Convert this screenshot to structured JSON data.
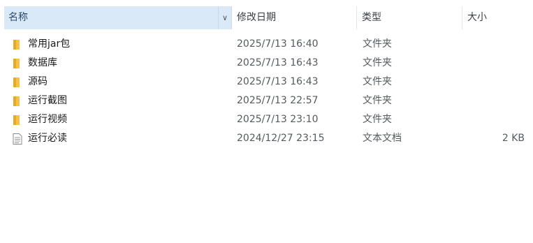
{
  "columns": {
    "name": "名称",
    "date": "修改日期",
    "type": "类型",
    "size": "大小"
  },
  "files": [
    {
      "name": "常用jar包",
      "date": "2025/7/13 16:40",
      "type": "文件夹",
      "size": "",
      "icon": "folder-icon"
    },
    {
      "name": "数据库",
      "date": "2025/7/13 16:43",
      "type": "文件夹",
      "size": "",
      "icon": "folder-icon"
    },
    {
      "name": "源码",
      "date": "2025/7/13 16:43",
      "type": "文件夹",
      "size": "",
      "icon": "folder-icon"
    },
    {
      "name": "运行截图",
      "date": "2025/7/13 22:57",
      "type": "文件夹",
      "size": "",
      "icon": "folder-icon"
    },
    {
      "name": "运行视频",
      "date": "2025/7/13 23:10",
      "type": "文件夹",
      "size": "",
      "icon": "folder-icon"
    },
    {
      "name": "运行必读",
      "date": "2024/12/27 23:15",
      "type": "文本文档",
      "size": "2 KB",
      "icon": "text-file-icon"
    }
  ],
  "colors": {
    "folder": "#f5c146",
    "header_selected": "#d9e9f8"
  }
}
